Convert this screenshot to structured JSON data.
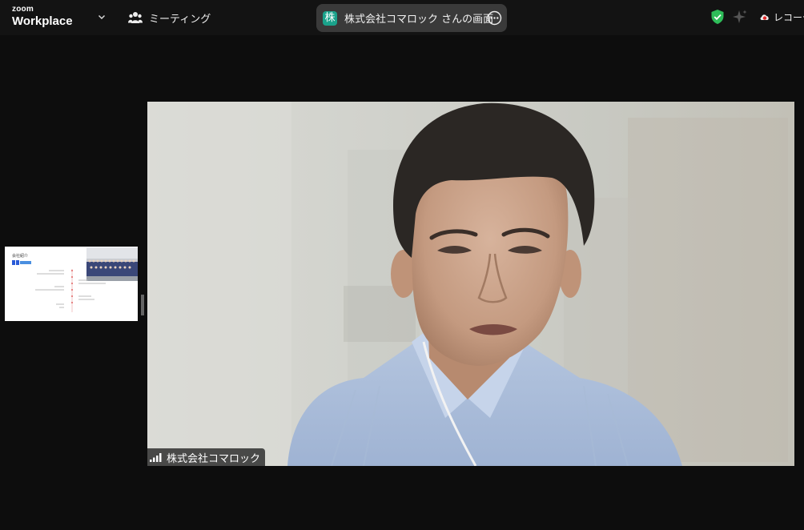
{
  "app": {
    "brand_small": "zoom",
    "brand_large": "Workplace"
  },
  "header": {
    "meetings_label": "ミーティング",
    "share_avatar_char": "株",
    "share_title": "株式会社コマロック さんの画面",
    "recording_label": "レコーデ"
  },
  "thumbnail": {
    "slide_title": "会社紹介"
  },
  "video": {
    "participant_name": "株式会社コマロック"
  },
  "colors": {
    "share_avatar": "#1aa28b",
    "shield": "#2ebd59",
    "record_dot": "#e02828"
  },
  "icons": {
    "meetings": "people-icon",
    "more": "ellipsis-circle-icon",
    "shield": "shield-check-icon",
    "ai": "sparkle-icon",
    "record": "cloud-record-icon",
    "signal": "signal-bars-icon"
  }
}
